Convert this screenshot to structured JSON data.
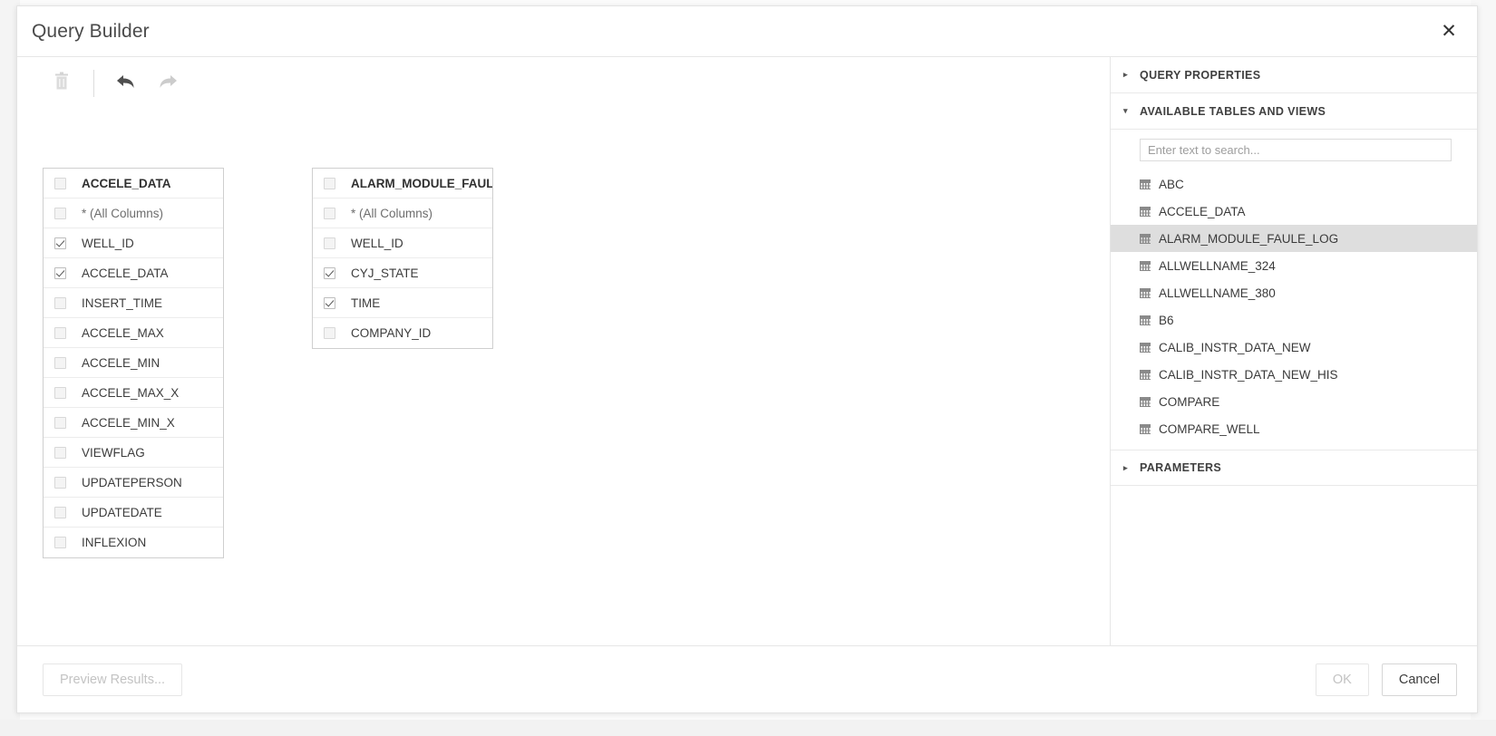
{
  "dialog": {
    "title": "Query Builder",
    "close_icon": "close-icon"
  },
  "toolbar": {
    "delete_icon": "trash-icon",
    "undo_icon": "undo-arrow-icon",
    "redo_icon": "redo-arrow-icon"
  },
  "canvas": {
    "tables": [
      {
        "name": "ACCELE_DATA",
        "header_checked": false,
        "columns": [
          {
            "label": "* (All Columns)",
            "checked": false
          },
          {
            "label": "WELL_ID",
            "checked": true
          },
          {
            "label": "ACCELE_DATA",
            "checked": true
          },
          {
            "label": "INSERT_TIME",
            "checked": false
          },
          {
            "label": "ACCELE_MAX",
            "checked": false
          },
          {
            "label": "ACCELE_MIN",
            "checked": false
          },
          {
            "label": "ACCELE_MAX_X",
            "checked": false
          },
          {
            "label": "ACCELE_MIN_X",
            "checked": false
          },
          {
            "label": "VIEWFLAG",
            "checked": false
          },
          {
            "label": "UPDATEPERSON",
            "checked": false
          },
          {
            "label": "UPDATEDATE",
            "checked": false
          },
          {
            "label": "INFLEXION",
            "checked": false
          }
        ]
      },
      {
        "name": "ALARM_MODULE_FAUL...",
        "header_checked": false,
        "columns": [
          {
            "label": "* (All Columns)",
            "checked": false
          },
          {
            "label": "WELL_ID",
            "checked": false
          },
          {
            "label": "CYJ_STATE",
            "checked": true
          },
          {
            "label": "TIME",
            "checked": true
          },
          {
            "label": "COMPANY_ID",
            "checked": false
          }
        ]
      }
    ]
  },
  "sidebar": {
    "sections": [
      {
        "title": "QUERY PROPERTIES",
        "expanded": false,
        "caret": "▸"
      },
      {
        "title": "AVAILABLE TABLES AND VIEWS",
        "expanded": true,
        "caret": "▾"
      },
      {
        "title": "PARAMETERS",
        "expanded": false,
        "caret": "▸"
      }
    ],
    "search": {
      "placeholder": "Enter text to search...",
      "value": ""
    },
    "tables": [
      {
        "label": "ABC",
        "selected": false
      },
      {
        "label": "ACCELE_DATA",
        "selected": false
      },
      {
        "label": "ALARM_MODULE_FAULE_LOG",
        "selected": true
      },
      {
        "label": "ALLWELLNAME_324",
        "selected": false
      },
      {
        "label": "ALLWELLNAME_380",
        "selected": false
      },
      {
        "label": "B6",
        "selected": false
      },
      {
        "label": "CALIB_INSTR_DATA_NEW",
        "selected": false
      },
      {
        "label": "CALIB_INSTR_DATA_NEW_HIS",
        "selected": false
      },
      {
        "label": "COMPARE",
        "selected": false
      },
      {
        "label": "COMPARE_WELL",
        "selected": false
      }
    ]
  },
  "footer": {
    "preview_label": "Preview Results...",
    "ok_label": "OK",
    "cancel_label": "Cancel",
    "preview_enabled": false,
    "ok_enabled": false
  },
  "colors": {
    "selection_bg": "#dedede",
    "border": "#e6e6e6",
    "text": "#3c3c3c"
  }
}
